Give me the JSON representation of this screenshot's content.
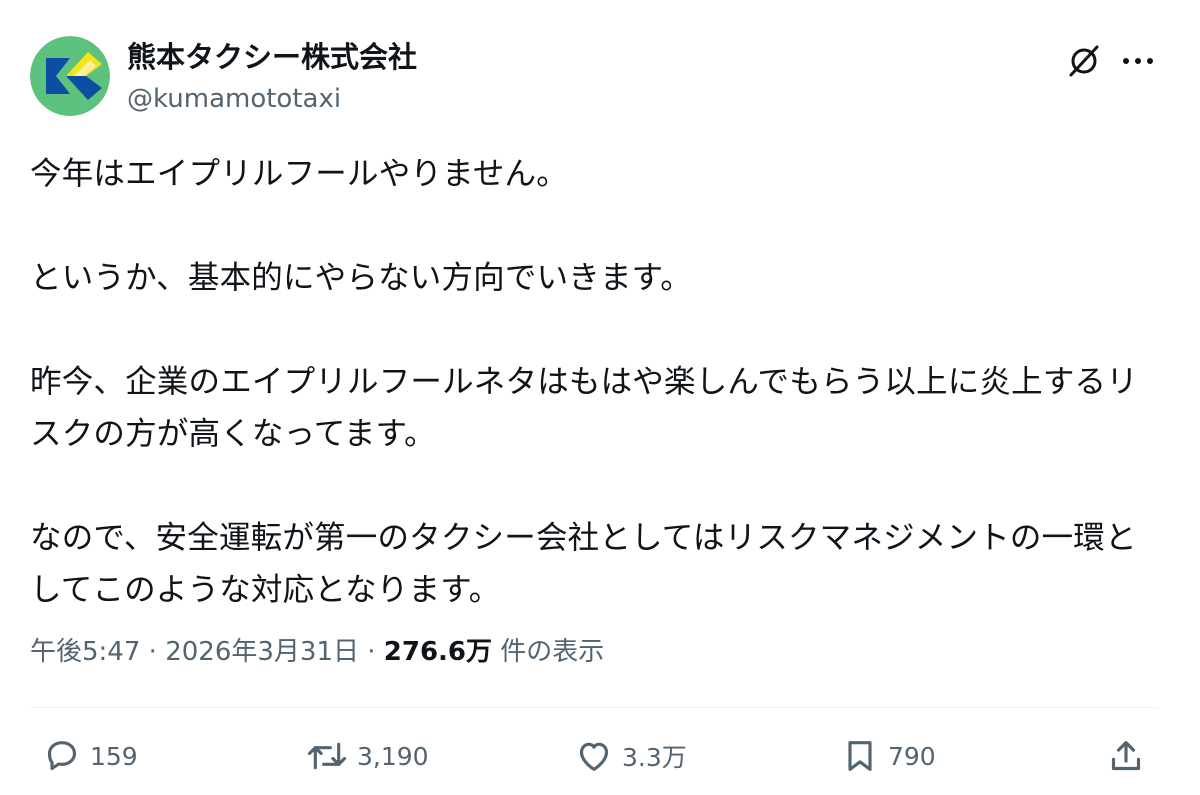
{
  "author": {
    "display_name": "熊本タクシー株式会社",
    "handle": "@kumamototaxi",
    "avatar_icon": "company-logo-avatar"
  },
  "header_actions": {
    "grok_icon": "grok-slash-icon",
    "more_icon": "more-dots-icon"
  },
  "post": {
    "paragraphs": [
      "今年はエイプリルフールやりません。",
      "というか、基本的にやらない方向でいきます。",
      "昨今、企業のエイプリルフールネタはもはや楽しんでもらう以上に炎上するリスクの方が高くなってます。",
      "なので、安全運転が第一のタクシー会社としてはリスクマネジメントの一環としてこのような対応となります。"
    ],
    "time": "午後5:47",
    "separator": "·",
    "date": "2026年3月31日",
    "views_count": "276.6万",
    "views_label": "件の表示"
  },
  "actions": {
    "reply_count": "159",
    "repost_count": "3,190",
    "like_count": "3.3万",
    "bookmark_count": "790"
  },
  "colors": {
    "text": "#0f1419",
    "secondary": "#536471",
    "divider": "#eff3f4",
    "logo_green": "#5cc27d",
    "logo_blue": "#0c4ea2",
    "logo_yellow": "#f5e31c"
  }
}
